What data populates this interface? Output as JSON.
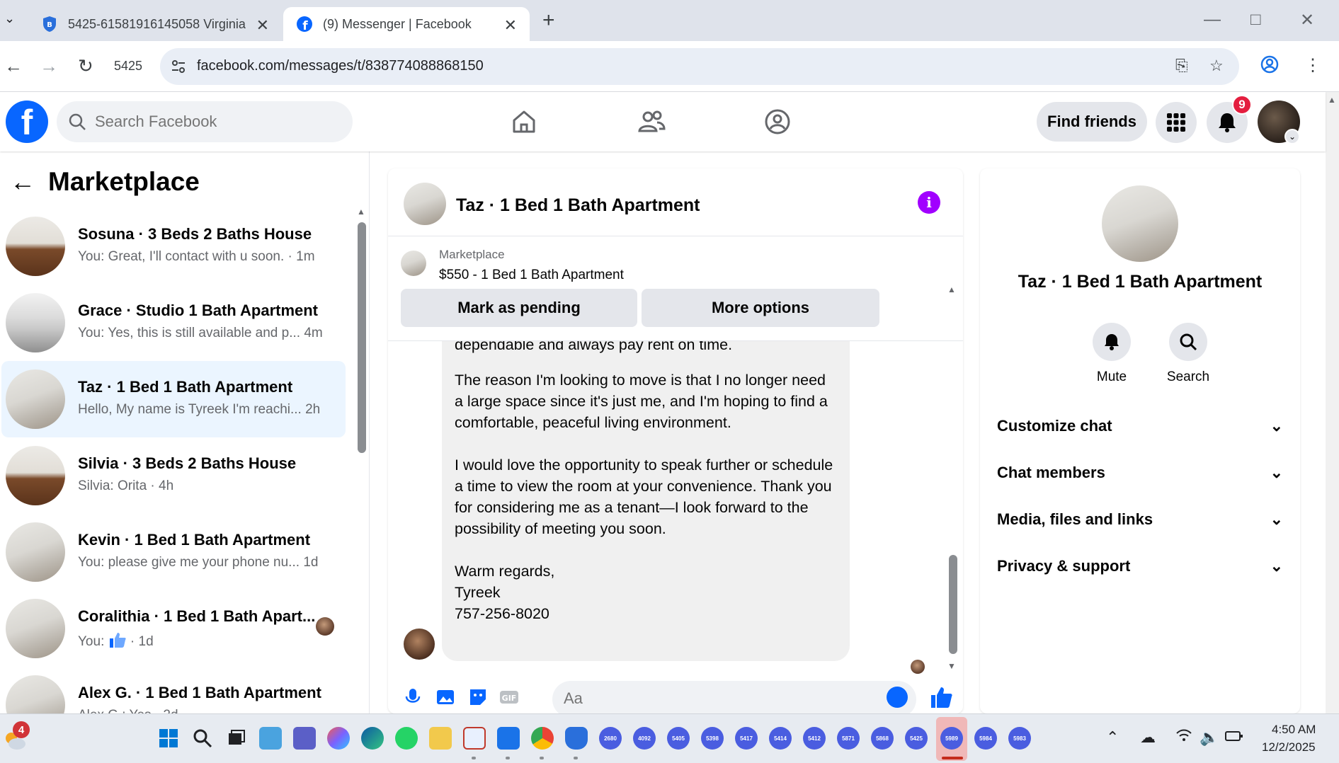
{
  "browser": {
    "tabs": [
      {
        "title": "5425-61581916145058 Virginia",
        "active": false
      },
      {
        "title": "(9) Messenger | Facebook",
        "active": true
      }
    ],
    "new_tab_symbol": "+",
    "profile_label": "5425",
    "url": "facebook.com/messages/t/838774088868150"
  },
  "header": {
    "search_placeholder": "Search Facebook",
    "find_friends_label": "Find friends",
    "notification_count": "9"
  },
  "sidebar": {
    "title": "Marketplace",
    "conversations": [
      {
        "name": "Sosuna · 3 Beds 2 Baths House",
        "preview": "You: Great, I'll contact with u soon.",
        "time": "1m",
        "thumb": "wood"
      },
      {
        "name": "Grace · Studio 1 Bath Apartment",
        "preview": "You: Yes, this is still available and p...",
        "time": "4m",
        "thumb": "kitchen"
      },
      {
        "name": "Taz · 1 Bed 1 Bath Apartment",
        "preview": "Hello, My name is Tyreek I'm reachi...",
        "time": "2h",
        "thumb": "room",
        "active": true
      },
      {
        "name": "Silvia · 3 Beds 2 Baths House",
        "preview": "Silvia: Orita",
        "time": "4h",
        "thumb": "wood"
      },
      {
        "name": "Kevin · 1 Bed 1 Bath Apartment",
        "preview": "You: please give me your phone nu...",
        "time": "1d",
        "thumb": "room"
      },
      {
        "name": "Coralithia · 1 Bed 1 Bath Apart...",
        "preview": "You:",
        "time": "1d",
        "thumb": "room",
        "like": true
      },
      {
        "name": "Alex G. · 1 Bed 1 Bath Apartment",
        "preview": "Alex G.: Yes",
        "time": "2d",
        "thumb": "room"
      }
    ]
  },
  "chat": {
    "title": "Taz · 1 Bed 1 Bath Apartment",
    "listing_source": "Marketplace",
    "listing_title": "$550 - 1 Bed 1 Bath Apartment",
    "mark_pending_label": "Mark as pending",
    "more_options_label": "More options",
    "message": {
      "partial_line": "dependable and always pay rent on time.",
      "paragraph_1": "The reason I'm looking to move is that I no longer need a large space since it's just me, and I'm hoping to find a comfortable, peaceful living environment.",
      "paragraph_2": "I would love the opportunity to speak further or schedule a time to view the room at your convenience. Thank you for considering me as a tenant—I look forward to the possibility of meeting you soon.",
      "signoff": "Warm regards,",
      "signature_name": "Tyreek",
      "signature_phone": "757-256-8020"
    },
    "input_placeholder": "Aa"
  },
  "info_panel": {
    "name": "Taz · 1 Bed 1 Bath Apartment",
    "mute_label": "Mute",
    "search_label": "Search",
    "sections": [
      "Customize chat",
      "Chat members",
      "Media, files and links",
      "Privacy & support"
    ]
  },
  "taskbar": {
    "weather_badge": "4",
    "time": "4:50 AM",
    "date": "12/2/2025",
    "app_labels": [
      "2680",
      "4092",
      "5405",
      "5398",
      "5417",
      "5414",
      "5412",
      "5871",
      "5868",
      "5425",
      "5989",
      "5984",
      "5983"
    ]
  },
  "colors": {
    "facebook_blue": "#0866ff",
    "active_convo_bg": "#ebf5ff",
    "info_purple": "#a100ff",
    "notification_red": "#e41e3f"
  }
}
